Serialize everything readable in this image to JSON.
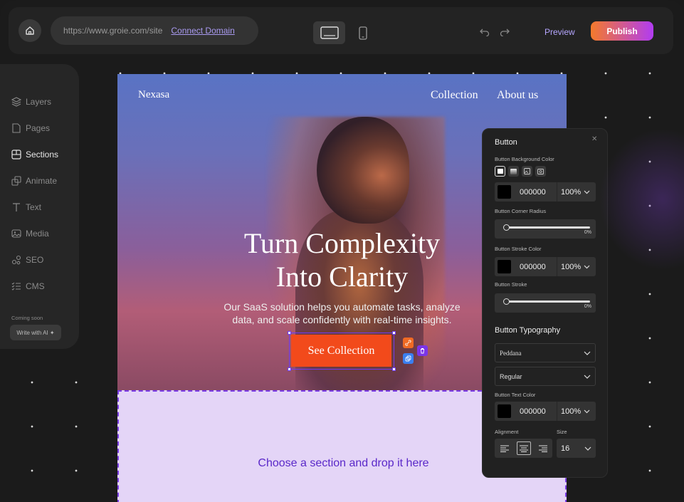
{
  "topbar": {
    "url": "https://www.groie.com/site",
    "connect_domain": "Connect Domain",
    "preview": "Preview",
    "publish": "Publish"
  },
  "sidebar": {
    "items": [
      {
        "label": "Layers",
        "icon": "layers-icon"
      },
      {
        "label": "Pages",
        "icon": "pages-icon"
      },
      {
        "label": "Sections",
        "icon": "sections-icon",
        "active": true
      },
      {
        "label": "Animate",
        "icon": "animate-icon"
      },
      {
        "label": "Text",
        "icon": "text-icon"
      },
      {
        "label": "Media",
        "icon": "media-icon"
      },
      {
        "label": "SEO",
        "icon": "seo-icon"
      },
      {
        "label": "CMS",
        "icon": "cms-icon"
      }
    ],
    "coming_soon": "Coming soon",
    "write_ai": "Write with AI ✦"
  },
  "site": {
    "brand": "Nexasa",
    "nav": [
      "Collection",
      "About  us"
    ],
    "hero_title_line1": "Turn Complexity",
    "hero_title_line2": "Into Clarity",
    "hero_sub_line1": "Our SaaS solution helps you automate tasks, analyze",
    "hero_sub_line2": "data, and scale confidently with real-time insights.",
    "cta": "See  Collection",
    "drop_text": "Choose a section and drop it here"
  },
  "panel": {
    "title": "Button",
    "bg_label": "Button Background Color",
    "bg_hex": "000000",
    "bg_opacity": "100%",
    "radius_label": "Button Corner Radius",
    "radius_value": "0%",
    "stroke_color_label": "Button Stroke Color",
    "stroke_hex": "000000",
    "stroke_opacity": "100%",
    "stroke_label": "Button Stroke",
    "stroke_value": "0%",
    "typography_label": "Button Typography",
    "font_family": "Peddana",
    "font_weight": "Regular",
    "text_color_label": "Button Text Color",
    "text_hex": "000000",
    "text_opacity": "100%",
    "alignment_label": "Alignment",
    "size_label": "Size",
    "size_value": "16"
  },
  "colors": {
    "accent": "#6f3cf2",
    "cta": "#f24a1b",
    "publish_start": "#f47a2b",
    "publish_end": "#b13cf2",
    "drop_zone": "#e4d5f7"
  }
}
